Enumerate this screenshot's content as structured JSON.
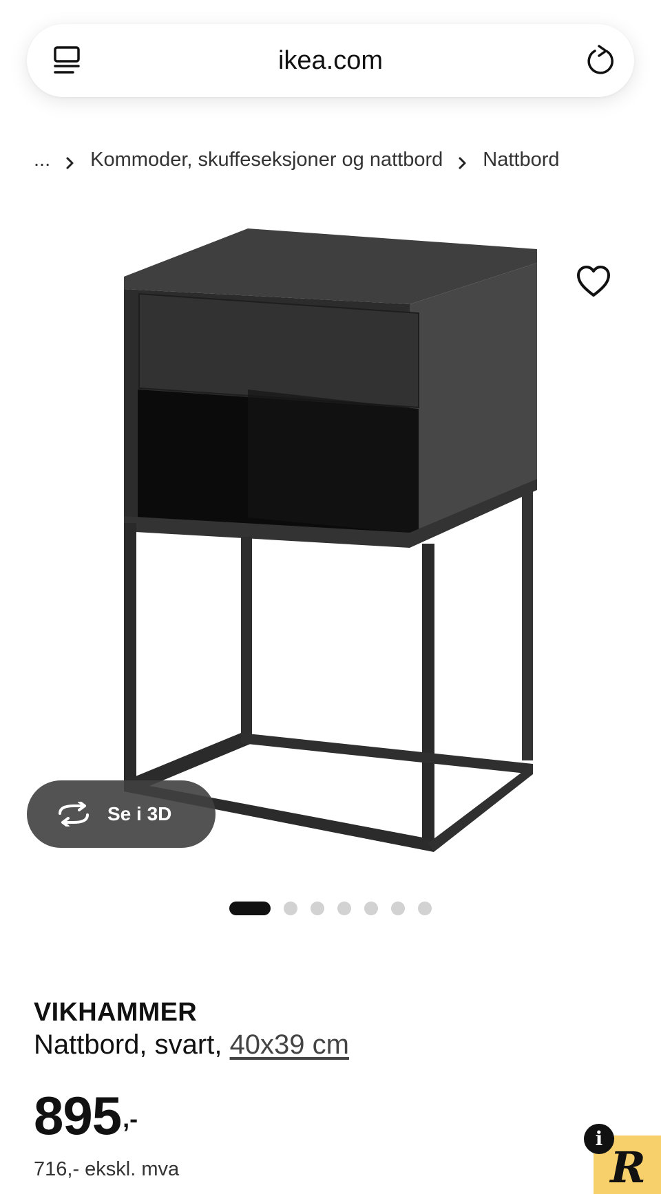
{
  "browser": {
    "url": "ikea.com",
    "tabs_icon": "tabs-icon",
    "reload_icon": "reload-icon"
  },
  "breadcrumb": {
    "ellipsis": "...",
    "items": [
      "Kommoder, skuffeseksjoner og nattbord",
      "Nattbord"
    ]
  },
  "gallery": {
    "view_3d_label": "Se i 3D",
    "total_images": 7,
    "active_index": 0
  },
  "product": {
    "name": "VIKHAMMER",
    "description_prefix": "Nattbord, svart, ",
    "size": "40x39 cm",
    "price": "895",
    "price_suffix": ",-",
    "price_ex_vat": "716,- ekskl. mva"
  },
  "badges": {
    "info_label": "i",
    "r_label": "R"
  },
  "colors": {
    "text": "#111111",
    "pill_bg": "#404040",
    "dot_inactive": "#d2d2d2",
    "badge_yellow": "#f7cf6b"
  }
}
